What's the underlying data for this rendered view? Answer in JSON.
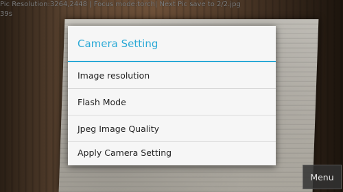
{
  "status": {
    "info_line": "Pic Resolution:3264,2448 | Focus mode:torch| Next Pic save to 2/2.jpg",
    "counter": "39s"
  },
  "dialog": {
    "title": "Camera Setting",
    "options": [
      {
        "label": "Image resolution"
      },
      {
        "label": "Flash Mode"
      },
      {
        "label": "Jpeg Image Quality"
      },
      {
        "label": "Apply Camera Setting"
      }
    ]
  },
  "menu_button": {
    "label": "Menu"
  },
  "colors": {
    "accent": "#2aa9d6",
    "dialog_bg": "#f6f6f6",
    "text": "#222222"
  }
}
